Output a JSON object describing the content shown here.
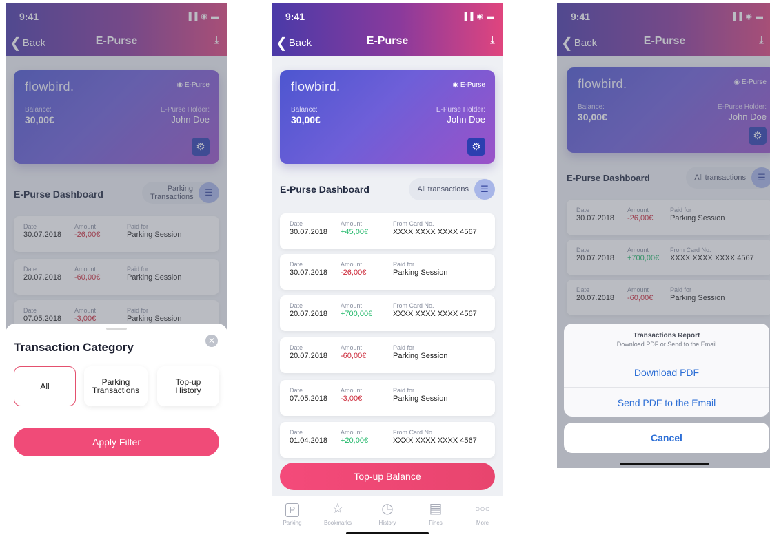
{
  "status": {
    "time": "9:41",
    "signal": "▐▐ ◉ ▬"
  },
  "nav": {
    "back": "Back",
    "title": "E-Purse",
    "download_icon": "download-icon"
  },
  "card": {
    "brand": "flowbird.",
    "badge": "E-Purse",
    "balance_label": "Balance:",
    "balance": "30,00€",
    "holder_label": "E-Purse Holder:",
    "holder": "John Doe"
  },
  "dashboard": {
    "title": "E-Purse Dashboard",
    "filter_parking": "Parking Transactions",
    "filter_all": "All transactions"
  },
  "labels": {
    "date": "Date",
    "amount": "Amount",
    "paid_for": "Paid for",
    "from_card": "From Card No."
  },
  "screen1": {
    "rows": [
      {
        "date": "30.07.2018",
        "amount": "-26,00€",
        "detail": "Parking Session"
      },
      {
        "date": "20.07.2018",
        "amount": "-60,00€",
        "detail": "Parking Session"
      },
      {
        "date": "07.05.2018",
        "amount": "-3,00€",
        "detail": "Parking Session"
      }
    ],
    "sheet": {
      "title": "Transaction Category",
      "opt_all": "All",
      "opt_parking": "Parking Transactions",
      "opt_topup": "Top-up History",
      "apply": "Apply Filter"
    }
  },
  "screen2": {
    "rows": [
      {
        "date": "30.07.2018",
        "amount": "+45,00€",
        "detail": "XXXX XXXX XXXX 4567"
      },
      {
        "date": "30.07.2018",
        "amount": "-26,00€",
        "detail": "Parking Session"
      },
      {
        "date": "20.07.2018",
        "amount": "+700,00€",
        "detail": "XXXX XXXX XXXX 4567"
      },
      {
        "date": "20.07.2018",
        "amount": "-60,00€",
        "detail": "Parking Session"
      },
      {
        "date": "07.05.2018",
        "amount": "-3,00€",
        "detail": "Parking Session"
      },
      {
        "date": "01.04.2018",
        "amount": "+20,00€",
        "detail": "XXXX XXXX XXXX 4567"
      }
    ],
    "topup": "Top-up Balance",
    "tabs": {
      "parking": "Parking",
      "bookmarks": "Bookmarks",
      "history": "History",
      "fines": "Fines",
      "more": "More"
    }
  },
  "screen3": {
    "rows": [
      {
        "date": "30.07.2018",
        "amount": "-26,00€",
        "detail": "Parking Session"
      },
      {
        "date": "20.07.2018",
        "amount": "+700,00€",
        "detail": "XXXX XXXX XXXX 4567"
      },
      {
        "date": "20.07.2018",
        "amount": "-60,00€",
        "detail": "Parking Session"
      }
    ],
    "actions": {
      "title": "Transactions Report",
      "subtitle": "Download PDF or Send to the Email",
      "download": "Download PDF",
      "email": "Send PDF to the Email",
      "cancel": "Cancel"
    }
  },
  "colors": {
    "accent": "#f04b78",
    "negative": "#cc2a3a",
    "positive": "#22b86a",
    "link": "#2d6fd6"
  }
}
